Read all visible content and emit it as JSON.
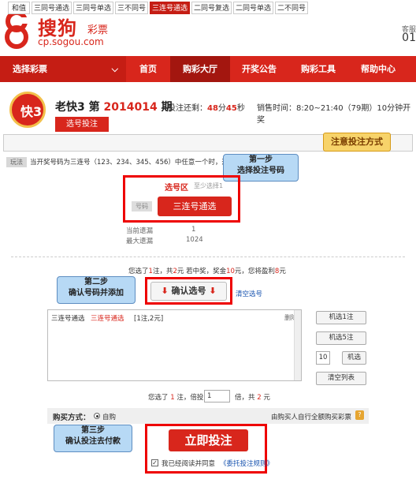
{
  "header": {
    "brand": "搜狗",
    "brand_sub": "彩票",
    "domain": "cp.sogou.com",
    "cs_label": "客服",
    "cs_number": "01"
  },
  "nav": {
    "select_lottery": "选择彩票",
    "items": [
      "首页",
      "购彩大厅",
      "开奖公告",
      "购彩工具",
      "帮助中心"
    ],
    "active": "购彩大厅"
  },
  "game": {
    "icon_text": "快3",
    "name": "老快3 第",
    "issue": "2014014",
    "issue_suffix": "期",
    "countdown_label": "投注还剩：",
    "countdown_min": "48",
    "countdown_min_unit": "分",
    "countdown_sec": "45",
    "countdown_sec_unit": "秒",
    "sale_time": "销售时间：8:20~21:40（79期）10分钟开奖",
    "select_bet_tab": "选号投注"
  },
  "play_tabs": {
    "items": [
      "和值",
      "三同号通选",
      "三同号单选",
      "三不同号",
      "三连号通选",
      "二同号复选",
      "二同号单选",
      "二不同号"
    ],
    "active": "三连号通选"
  },
  "annotations": {
    "choose_method": "注意投注方式",
    "step1_title": "第一步",
    "step1_text": "选择投注号码",
    "step2_title": "第二步",
    "step2_text": "确认号码并添加",
    "step3_title": "第三步",
    "step3_text": "确认投注去付款"
  },
  "rule": {
    "badge": "玩法",
    "text": "当开奖号码为三连号（123、234、345、456）中任意一个时，选号"
  },
  "select_area": {
    "label": "选号区",
    "min_hint": "至少选择1",
    "number_badge": "号码",
    "button": "三连号通选",
    "current_miss_label": "当前遗漏",
    "current_miss": "1",
    "max_miss_label": "最大遗漏",
    "max_miss": "1024"
  },
  "summary": {
    "p1": "您选了",
    "bets": "1",
    "p2": "注，共",
    "amount": "2",
    "p3": "元 若中奖，奖金",
    "prize": "10",
    "p4": "元，您将盈利",
    "profit": "8",
    "p5": "元"
  },
  "confirm": {
    "arrow": "⬇",
    "label": "确认选号",
    "clear": "清空选号"
  },
  "selection_list": {
    "name": "三连号通选",
    "value": "三连号通选",
    "count": "[1注,2元]",
    "delete": "删除"
  },
  "side_buttons": {
    "random1": "机选1注",
    "random5": "机选5注",
    "qty": "10",
    "random_n": "机选",
    "clear_list": "清空列表"
  },
  "multiple": {
    "p1": "您选了",
    "bets": "1",
    "p2": "注，倍投",
    "value": "1",
    "p3": "倍，共",
    "amount": "2",
    "p4": "元"
  },
  "buy_method": {
    "label": "购买方式：",
    "self": "自购",
    "note": "由购买人自行全额购买彩票",
    "help": "?"
  },
  "bet": {
    "button": "立即投注",
    "agree": "我已经阅读并同意",
    "agree_link": "《委托投注规则》",
    "check": "✓"
  }
}
